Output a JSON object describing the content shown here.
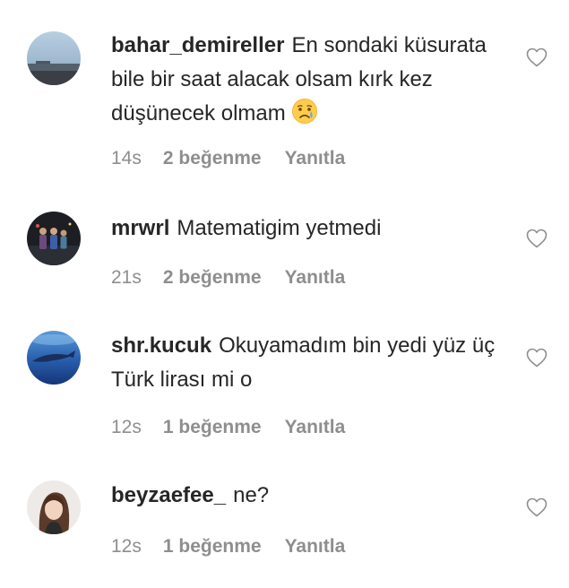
{
  "comments": [
    {
      "username": "bahar_demireller",
      "text": "En sondaki küsurata bile bir saat alacak olsam kırk kez düşünecek olmam",
      "emoji": "crying-face-emoji",
      "time": "14s",
      "likes": "2 beğenme",
      "reply": "Yanıtla"
    },
    {
      "username": "mrwrl",
      "text": "Matematigim yetmedi",
      "time": "21s",
      "likes": "2 beğenme",
      "reply": "Yanıtla"
    },
    {
      "username": "shr.kucuk",
      "text": "Okuyamadım bin yedi yüz üç Türk lirası mi o",
      "time": "12s",
      "likes": "1 beğenme",
      "reply": "Yanıtla"
    },
    {
      "username": "beyzaefee_",
      "text": "ne?",
      "time": "12s",
      "likes": "1 beğenme",
      "reply": "Yanıtla"
    }
  ],
  "icons": {
    "like": "heart-outline-icon"
  },
  "colors": {
    "text": "#262626",
    "meta": "#8e8e8e",
    "background": "#ffffff"
  }
}
